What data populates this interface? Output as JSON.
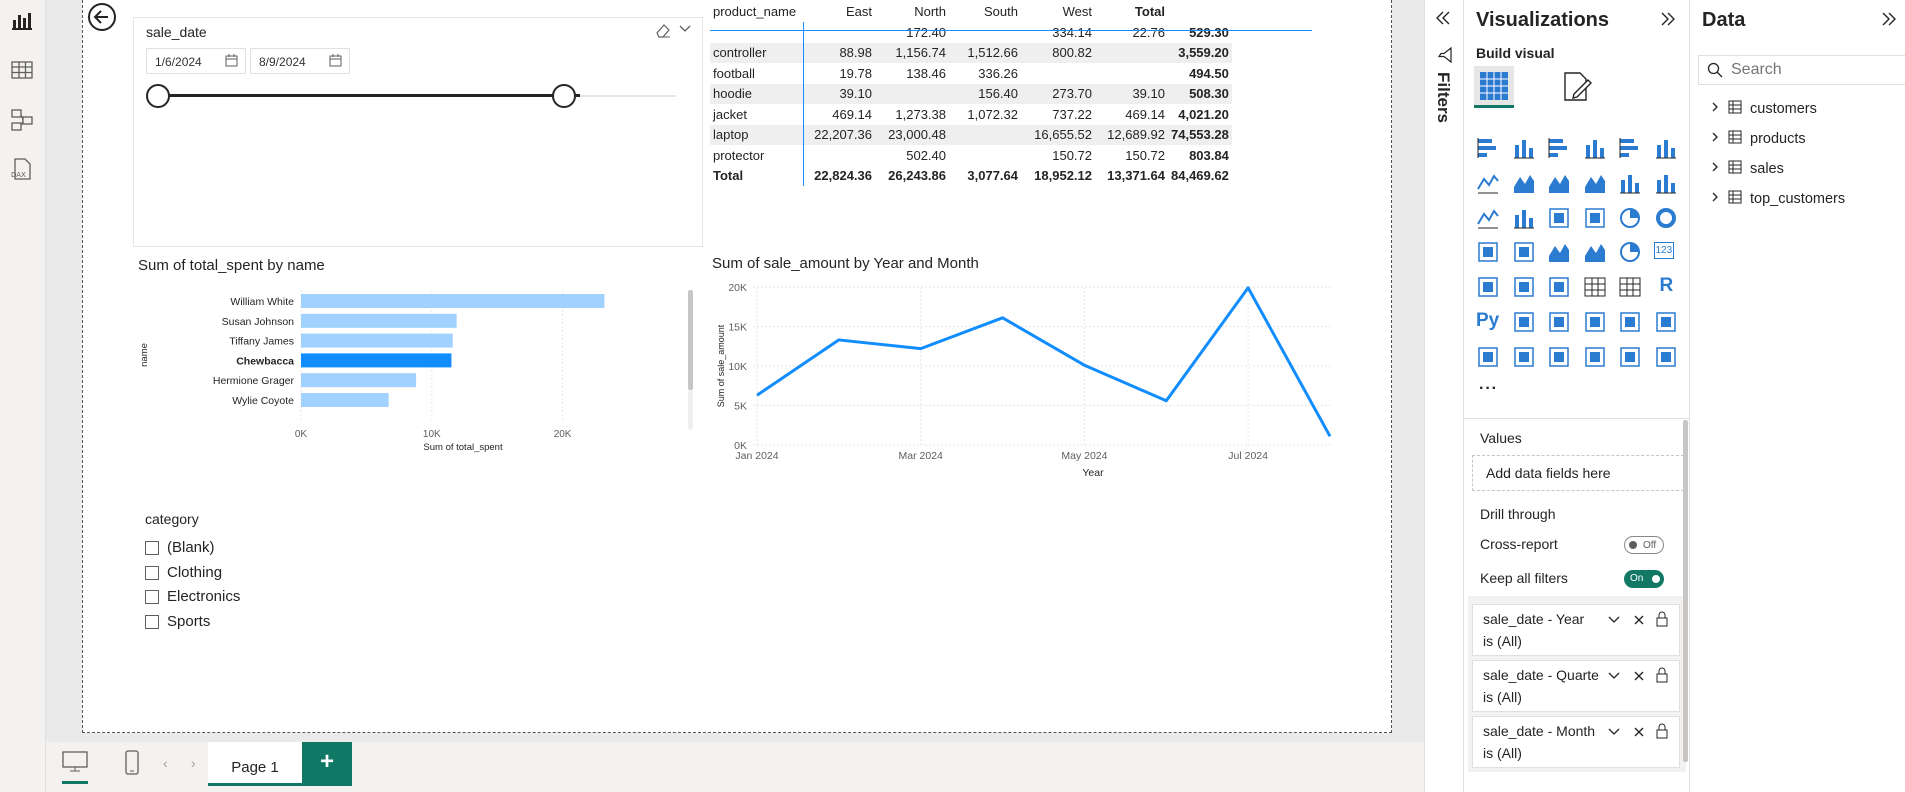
{
  "nav": {
    "items": [
      {
        "name": "report-view-icon"
      },
      {
        "name": "table-view-icon"
      },
      {
        "name": "model-view-icon"
      },
      {
        "name": "dax-query-view-icon",
        "label": "DAX"
      }
    ]
  },
  "slicer": {
    "title": "sale_date",
    "start_date": "1/6/2024",
    "end_date": "8/9/2024"
  },
  "matrix": {
    "headers": [
      "product_name",
      "East",
      "North",
      "South",
      "West",
      "Total"
    ],
    "rows": [
      {
        "label": "",
        "values": [
          "",
          "172.40",
          "334.14",
          "22.76",
          "529.30"
        ],
        "cols": [
          "",
          "172.40",
          "",
          "334.14",
          "22.76"
        ]
      },
      {
        "label": "controller",
        "cols": [
          "88.98",
          "1,156.74",
          "1,512.66",
          "800.82",
          ""
        ],
        "total": "3,559.20"
      },
      {
        "label": "football",
        "cols": [
          "19.78",
          "138.46",
          "336.26",
          "",
          ""
        ],
        "total": "494.50"
      },
      {
        "label": "hoodie",
        "cols": [
          "39.10",
          "",
          "156.40",
          "273.70",
          "39.10"
        ],
        "total": "508.30"
      },
      {
        "label": "jacket",
        "cols": [
          "469.14",
          "1,273.38",
          "1,072.32",
          "737.22",
          "469.14"
        ],
        "total": "4,021.20"
      },
      {
        "label": "laptop",
        "cols": [
          "22,207.36",
          "23,000.48",
          "",
          "16,655.52",
          "12,689.92"
        ],
        "total": "74,553.28"
      },
      {
        "label": "protector",
        "cols": [
          "",
          "502.40",
          "",
          "150.72",
          "150.72"
        ],
        "total": "803.84"
      },
      {
        "label": "Total",
        "cols": [
          "22,824.36",
          "26,243.86",
          "3,077.64",
          "18,952.12",
          "13,371.64"
        ],
        "total": "84,469.62"
      }
    ]
  },
  "bar_chart_title": "Sum of total_spent by name",
  "line_chart_title": "Sum of sale_amount by Year and Month",
  "chart_data": [
    {
      "type": "bar",
      "orientation": "horizontal",
      "title": "Sum of total_spent by name",
      "categories": [
        "William White",
        "Susan Johnson",
        "Tiffany James",
        "Chewbacca",
        "Hermione Grager",
        "Wylie Coyote"
      ],
      "values": [
        23200,
        11900,
        11600,
        11500,
        8800,
        6700
      ],
      "highlighted": "Chewbacca",
      "xlabel": "Sum of total_spent",
      "ylabel": "name",
      "xticks": [
        "0K",
        "10K",
        "20K"
      ],
      "xlim": [
        0,
        25000
      ],
      "colors": {
        "bar": "#a0d1ff",
        "highlight": "#118dff"
      }
    },
    {
      "type": "line",
      "title": "Sum of sale_amount by Year and Month",
      "x": [
        "2024-01",
        "2024-02",
        "2024-03",
        "2024-04",
        "2024-05",
        "2024-06",
        "2024-07",
        "2024-08"
      ],
      "values": [
        6300,
        13300,
        12200,
        16100,
        10100,
        5600,
        19900,
        1100
      ],
      "xlabel": "Year",
      "ylabel": "Sum of sale_amount",
      "xticks": [
        "Jan 2024",
        "Mar 2024",
        "May 2024",
        "Jul 2024"
      ],
      "yticks": [
        "0K",
        "5K",
        "10K",
        "15K",
        "20K"
      ],
      "ylim": [
        0,
        20000
      ],
      "colors": {
        "line": "#118dff"
      }
    }
  ],
  "category_slicer": {
    "title": "category",
    "options": [
      "(Blank)",
      "Clothing",
      "Electronics",
      "Sports"
    ]
  },
  "bottom": {
    "page_tab": "Page 1",
    "add_label": "+"
  },
  "filters": {
    "label": "Filters"
  },
  "vis": {
    "title": "Visualizations",
    "build_visual": "Build visual",
    "values_label": "Values",
    "add_fields": "Add data fields here",
    "drill_through": "Drill through",
    "cross_report": "Cross-report",
    "cross_report_state": "Off",
    "keep_filters": "Keep all filters",
    "keep_filters_state": "On",
    "wells": [
      {
        "line1": "sale_date - Year",
        "line2": "is (All)"
      },
      {
        "line1": "sale_date - Quarte",
        "line2": "is (All)"
      },
      {
        "line1": "sale_date - Month",
        "line2": "is (All)"
      }
    ],
    "more": "···",
    "py_label": "Py",
    "r_label": "R",
    "card_label": "123"
  },
  "data": {
    "title": "Data",
    "search_placeholder": "Search",
    "tables": [
      "customers",
      "products",
      "sales",
      "top_customers"
    ]
  },
  "colors": {
    "accent": "#118dff",
    "bar_light": "#a0d1ff",
    "green": "#117865"
  }
}
